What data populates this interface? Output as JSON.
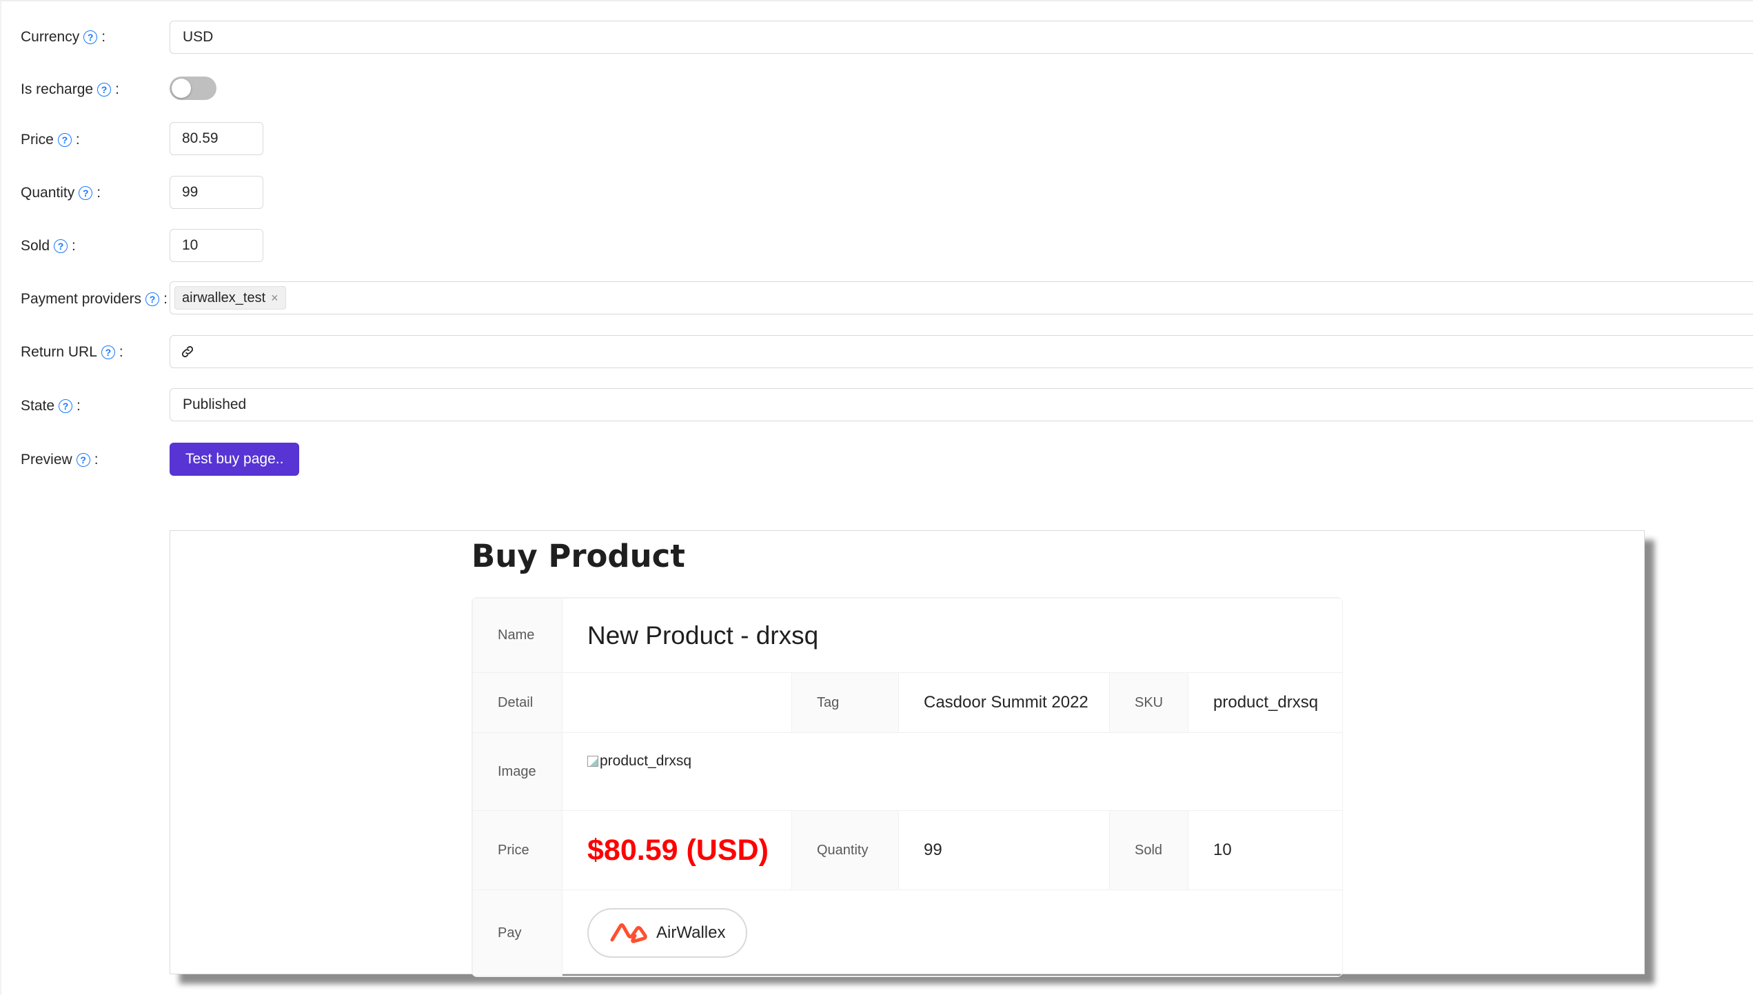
{
  "form": {
    "currency": {
      "label": "Currency",
      "value": "USD"
    },
    "is_recharge": {
      "label": "Is recharge",
      "checked": false
    },
    "price": {
      "label": "Price",
      "value": "80.59"
    },
    "quantity": {
      "label": "Quantity",
      "value": "99"
    },
    "sold": {
      "label": "Sold",
      "value": "10"
    },
    "payment_providers": {
      "label": "Payment providers",
      "tags": [
        "airwallex_test"
      ]
    },
    "return_url": {
      "label": "Return URL",
      "value": ""
    },
    "state": {
      "label": "State",
      "value": "Published"
    },
    "preview": {
      "label": "Preview",
      "button_label": "Test buy page.."
    }
  },
  "help_glyph": "?",
  "colon": ":",
  "tag_close_glyph": "×",
  "preview_panel": {
    "title": "Buy Product",
    "labels": {
      "name": "Name",
      "detail": "Detail",
      "tag": "Tag",
      "sku": "SKU",
      "image": "Image",
      "price": "Price",
      "quantity": "Quantity",
      "sold": "Sold",
      "pay": "Pay"
    },
    "values": {
      "name": "New Product - drxsq",
      "detail": "",
      "tag": "Casdoor Summit 2022",
      "sku": "product_drxsq",
      "image_alt": "product_drxsq",
      "price": "$80.59 (USD)",
      "quantity": "99",
      "sold": "10"
    },
    "pay_button": {
      "label": "AirWallex",
      "logo_color": "#ff4f2e"
    }
  },
  "colors": {
    "primary": "#5734d3",
    "help_icon": "#1677ff",
    "price_red": "#ff0000",
    "toggle_off": "#bfbfbf"
  }
}
